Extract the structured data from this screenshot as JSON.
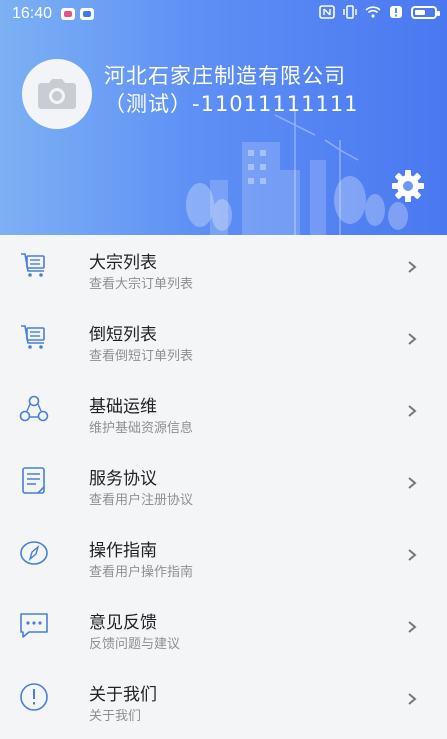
{
  "status_bar": {
    "time": "16:40"
  },
  "header": {
    "company_line1": "河北石家庄制造有限公司",
    "company_line2": "（测试）-11011111111",
    "accent_gradient": [
      "#7cb1f4",
      "#4a78f0"
    ]
  },
  "menu": [
    {
      "title": "大宗列表",
      "subtitle": "查看大宗订单列表",
      "icon": "cart-icon"
    },
    {
      "title": "倒短列表",
      "subtitle": "查看倒短订单列表",
      "icon": "cart-icon"
    },
    {
      "title": "基础运维",
      "subtitle": "维护基础资源信息",
      "icon": "nodes-icon"
    },
    {
      "title": "服务协议",
      "subtitle": "查看用户注册协议",
      "icon": "document-icon"
    },
    {
      "title": "操作指南",
      "subtitle": "查看用户操作指南",
      "icon": "compass-icon"
    },
    {
      "title": "意见反馈",
      "subtitle": "反馈问题与建议",
      "icon": "chat-icon"
    },
    {
      "title": "关于我们",
      "subtitle": "关于我们",
      "icon": "info-icon"
    }
  ]
}
